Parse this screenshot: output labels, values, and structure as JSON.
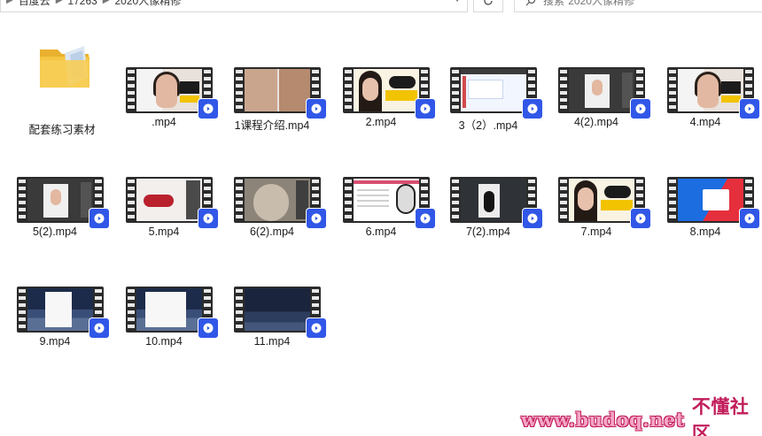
{
  "address_bar": {
    "crumbs": [
      "百度云",
      "17263",
      "2020人像精修"
    ]
  },
  "search": {
    "placeholder": "搜索\"2020人像精修\""
  },
  "files": [
    {
      "name": "配套练习素材",
      "kind": "folder"
    },
    {
      "name": ".mp4",
      "kind": "video",
      "thumb": "portrait"
    },
    {
      "name": "1课程介绍.mp4",
      "kind": "video",
      "thumb": "faces"
    },
    {
      "name": "2.mp4",
      "kind": "video",
      "thumb": "banner"
    },
    {
      "name": "3（2）.mp4",
      "kind": "video",
      "thumb": "app"
    },
    {
      "name": "4(2).mp4",
      "kind": "video",
      "thumb": "ps"
    },
    {
      "name": "4.mp4",
      "kind": "video",
      "thumb": "portrait"
    },
    {
      "name": "5(2).mp4",
      "kind": "video",
      "thumb": "ps"
    },
    {
      "name": "5.mp4",
      "kind": "video",
      "thumb": "lips"
    },
    {
      "name": "6(2).mp4",
      "kind": "video",
      "thumb": "old"
    },
    {
      "name": "6.mp4",
      "kind": "video",
      "thumb": "slide"
    },
    {
      "name": "7(2).mp4",
      "kind": "video",
      "thumb": "dark"
    },
    {
      "name": "7.mp4",
      "kind": "video",
      "thumb": "banner"
    },
    {
      "name": "8.mp4",
      "kind": "video",
      "thumb": "brand"
    },
    {
      "name": "9.mp4",
      "kind": "video",
      "thumb": "desert"
    },
    {
      "name": "10.mp4",
      "kind": "video",
      "thumb": "desert"
    },
    {
      "name": "11.mp4",
      "kind": "video",
      "thumb": "night"
    }
  ],
  "watermark": {
    "url": "www.budoq.net",
    "cn": "不懂社区"
  },
  "colors": {
    "play_badge": "#3157e8",
    "folder": "#f5c542",
    "watermark": "#c11d5b"
  }
}
